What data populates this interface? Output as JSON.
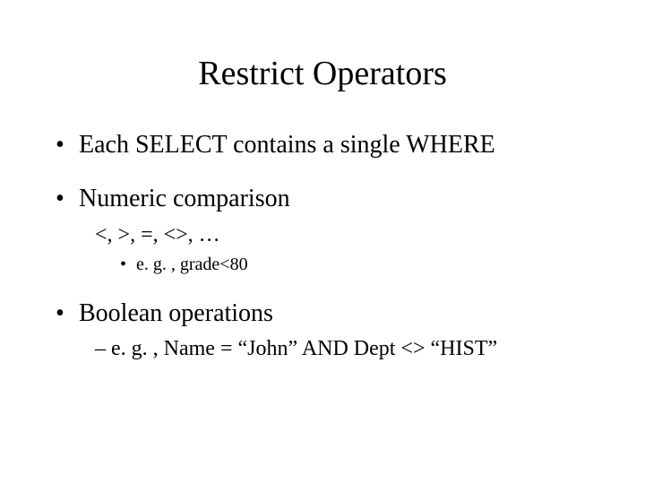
{
  "title": "Restrict Operators",
  "bullets": {
    "b1": "Each SELECT contains a single WHERE",
    "b2": "Numeric comparison",
    "b2_sub": "<, >, =, <>, …",
    "b2_eg": "e. g. , grade<80",
    "b3": "Boolean operations",
    "b3_sub": "– e. g. , Name = “John” AND Dept <> “HIST”"
  }
}
